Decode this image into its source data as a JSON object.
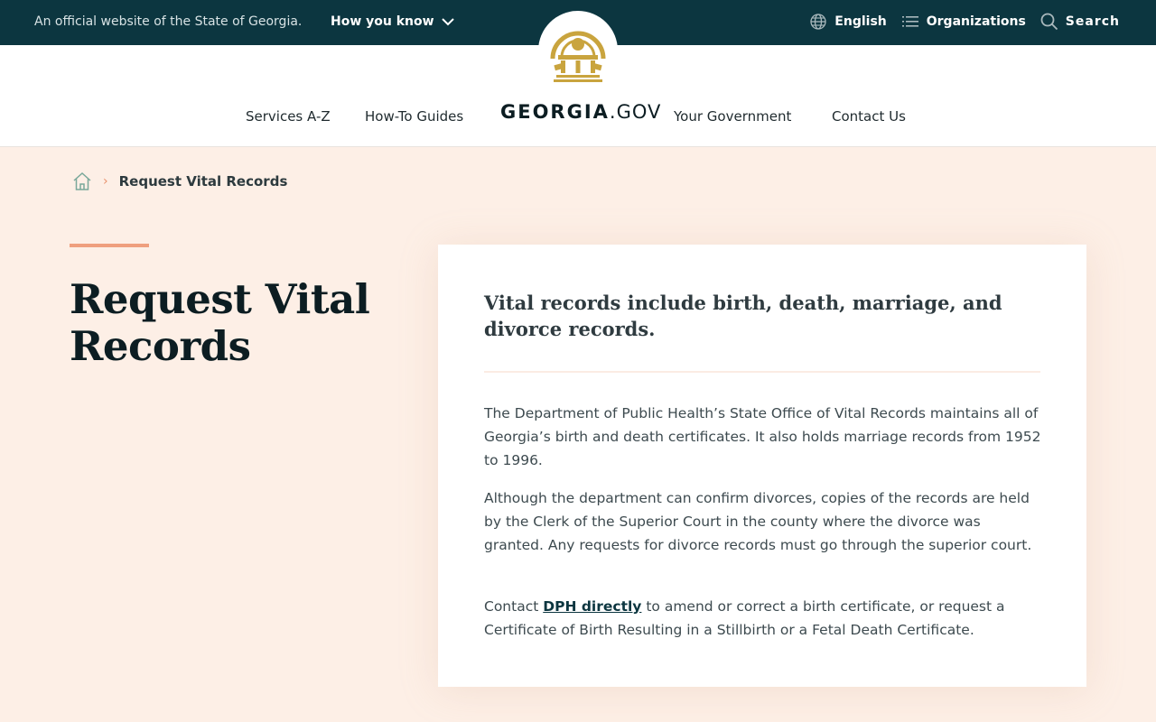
{
  "banner": {
    "official_text": "An official website of the State of Georgia.",
    "how_you_know": "How you know",
    "language": "English",
    "organizations": "Organizations",
    "search": "Search"
  },
  "header": {
    "logo_strong": "GEORGIA",
    "logo_light": ".GOV",
    "nav": [
      {
        "label": "Services A-Z"
      },
      {
        "label": "How-To Guides"
      },
      {
        "label": "Your Government"
      },
      {
        "label": "Contact Us"
      }
    ]
  },
  "breadcrumb": {
    "current": "Request Vital Records"
  },
  "page": {
    "title": "Request Vital Records",
    "lead": "Vital records include birth, death, marriage, and divorce records.",
    "paragraph1": "The Department of Public Health’s State Office of Vital Records maintains all of Georgia’s birth and death certificates. It also holds marriage records from 1952 to 1996.",
    "paragraph2": "Although the department can confirm divorces, copies of the records are held by the Clerk of the Superior Court in the county where the divorce was granted. Any requests for divorce records must go through the superior court.",
    "paragraph3_before": "Contact ",
    "paragraph3_link": "DPH directly",
    "paragraph3_after": " to amend or correct a birth certificate, or request a Certificate of Birth Resulting in a Stillbirth or a Fetal Death Certificate."
  },
  "colors": {
    "banner_bg": "#0c3640",
    "page_bg": "#fdefe6",
    "accent": "#ef9f7e",
    "seal_gold": "#c9a43e"
  }
}
